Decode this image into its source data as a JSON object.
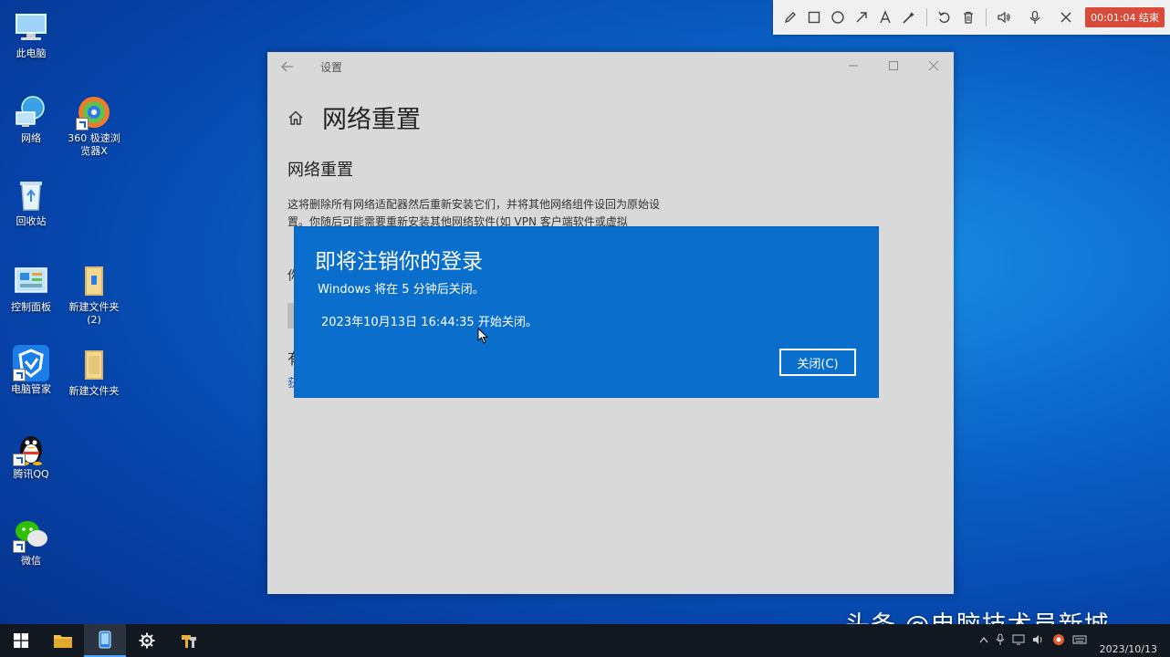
{
  "desktop": {
    "icons": [
      {
        "label": "此电脑"
      },
      {
        "label": "网络"
      },
      {
        "label": "360 极速浏览器X"
      },
      {
        "label": "回收站"
      },
      {
        "label": "控制面板"
      },
      {
        "label": "新建文件夹 (2)"
      },
      {
        "label": "电脑管家"
      },
      {
        "label": "新建文件夹"
      },
      {
        "label": "腾讯QQ"
      },
      {
        "label": "微信"
      }
    ]
  },
  "recorder": {
    "tools": [
      "pen-icon",
      "rectangle-icon",
      "circle-icon",
      "arrow-icon",
      "text-icon",
      "magic-wand-icon",
      "undo-icon",
      "trash-icon",
      "speaker-icon",
      "microphone-icon",
      "close-icon"
    ],
    "timer": "00:01:04 结束"
  },
  "settings": {
    "window_title": "设置",
    "page_title": "网络重置",
    "section_title": "网络重置",
    "description": "这将删除所有网络适配器然后重新安装它们，并将其他网络组件设回为原始设置。你随后可能需要重新安装其他网络软件(如 VPN 客户端软件或虚拟",
    "partial_1": "你",
    "partial_2": "有",
    "partial_3": "获"
  },
  "dialog": {
    "title": "即将注销你的登录",
    "line1": "Windows 将在 5 分钟后关闭。",
    "line2": "2023年10月13日 16:44:35 开始关闭。",
    "close_button": "关闭(C)"
  },
  "taskbar": {
    "date": "2023/10/13"
  },
  "watermark": "头条 @电脑技术员新城"
}
